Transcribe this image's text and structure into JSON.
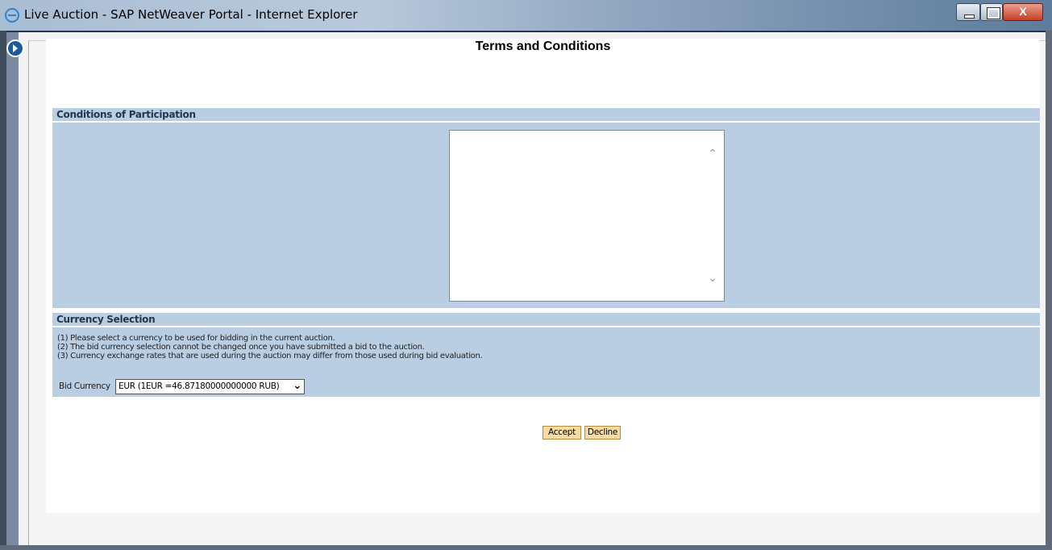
{
  "window": {
    "title": "Live Auction - SAP NetWeaver Portal - Internet Explorer",
    "close_glyph": "X"
  },
  "page": {
    "title": "Terms and Conditions"
  },
  "conditions": {
    "header": "Conditions of Participation",
    "text": ""
  },
  "currency": {
    "header": "Currency Selection",
    "notes": [
      "(1) Please select a currency to be used for bidding in the current auction.",
      "(2) The bid currency selection cannot be changed once you have submitted a bid to the auction.",
      "(3) Currency exchange rates that are used during the auction may differ from those used during bid evaluation."
    ],
    "bid_label": "Bid Currency",
    "bid_value": "EUR (1EUR =46.87180000000000 RUB)"
  },
  "actions": {
    "accept": "Accept",
    "decline": "Decline"
  },
  "icons": {
    "browser": "ie-icon",
    "nav": "nav-toggle-icon"
  }
}
